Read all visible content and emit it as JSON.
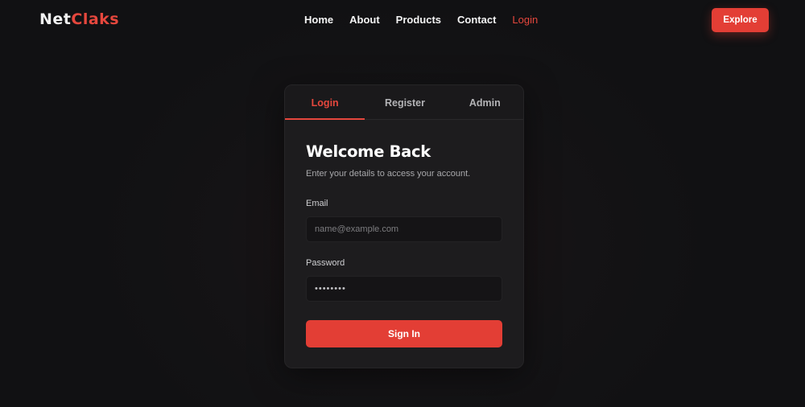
{
  "brand": {
    "part1": "Net",
    "part2": "Claks"
  },
  "nav": {
    "links": [
      {
        "label": "Home"
      },
      {
        "label": "About"
      },
      {
        "label": "Products"
      },
      {
        "label": "Contact"
      },
      {
        "label": "Login",
        "active": true
      }
    ],
    "cta_label": "Explore"
  },
  "card": {
    "tabs": [
      {
        "label": "Login",
        "active": true
      },
      {
        "label": "Register"
      },
      {
        "label": "Admin"
      }
    ],
    "title": "Welcome Back",
    "subtitle": "Enter your details to access your account.",
    "email": {
      "label": "Email",
      "placeholder": "name@example.com",
      "value": ""
    },
    "password": {
      "label": "Password",
      "value": "••••••••"
    },
    "submit_label": "Sign In"
  },
  "colors": {
    "accent": "#e33e35",
    "background": "#141315",
    "card": "#1d1c1e"
  }
}
